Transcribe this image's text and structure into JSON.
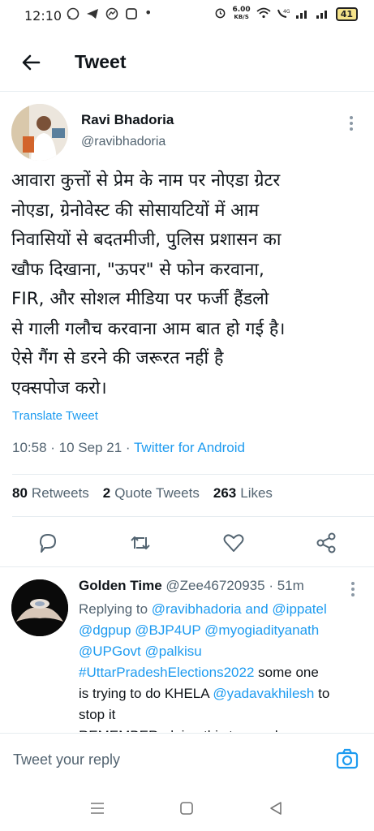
{
  "status_bar": {
    "time": "12:10",
    "net_speed_value": "6.00",
    "net_speed_unit": "KB/S",
    "battery": "41"
  },
  "header": {
    "title": "Tweet"
  },
  "tweet": {
    "author_name": "Ravi Bhadoria",
    "author_handle": "@ravibhadoria",
    "text_lines": [
      "आवारा कुत्तों से प्रेम के नाम पर नोएडा ग्रेटर",
      "नोएडा, ग्रेनोवेस्ट की सोसायटियों में आम",
      "निवासियों से बदतमीजी, पुलिस प्रशासन का",
      "खौफ दिखाना, \"ऊपर\" से फोन करवाना,",
      "FIR, और सोशल मीडिया पर फर्जी हैंडलो",
      "से गाली गलौच करवाना आम बात हो गई है।",
      "ऐसे गैंग से डरने की जरूरत नहीं है",
      "एक्सपोज करो।"
    ],
    "translate_label": "Translate Tweet",
    "timestamp": "10:58 · 10 Sep 21 · ",
    "source": "Twitter for Android",
    "retweets_count": "80",
    "retweets_label": "Retweets",
    "quote_count": "2",
    "quote_label": "Quote Tweets",
    "likes_count": "263",
    "likes_label": "Likes"
  },
  "reply": {
    "author_name": "Golden Time",
    "author_handle": "@Zee46720935",
    "time": "· 51m",
    "replying_prefix": "Replying to ",
    "replying_users": "@ravibhadoria and @ippatel",
    "line2": "@dgpup @BJP4UP @myogiadityanath",
    "line3": "@UPGovt @palkisu",
    "hashtag": "#UttarPradeshElections2022",
    "line4_rest": " some one",
    "line5_text": "is trying to do KHELA ",
    "line5_mention": "@yadavakhilesh",
    "line5_end": " to",
    "line6": "stop it",
    "line7": "REMEMBER, doing this to people"
  },
  "compose": {
    "placeholder": "Tweet your reply"
  },
  "icons": {
    "back": "arrow-left-icon",
    "reply": "reply-icon",
    "retweet": "retweet-icon",
    "like": "heart-icon",
    "share": "share-icon",
    "camera": "camera-icon"
  },
  "colors": {
    "accent": "#1d9bf0",
    "text": "#0f1419",
    "muted": "#536471"
  }
}
